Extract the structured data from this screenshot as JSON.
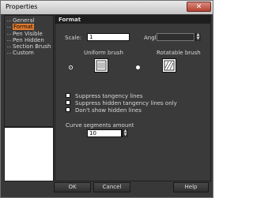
{
  "window": {
    "title": "Properties"
  },
  "sidebar": {
    "items": [
      {
        "label": "General"
      },
      {
        "label": "Format"
      },
      {
        "label": "Pen Visible"
      },
      {
        "label": "Pen Hidden"
      },
      {
        "label": "Section Brush"
      },
      {
        "label": "Custom"
      }
    ],
    "selected_index": 1
  },
  "panel": {
    "title": "Format",
    "scale": {
      "label": "Scale:",
      "value": "1"
    },
    "angle": {
      "label": "Angle:",
      "value": ""
    },
    "brush": {
      "uniform_label": "Uniform brush",
      "rotatable_label": "Rotatable brush",
      "selected": "uniform"
    },
    "checkboxes": [
      {
        "label": "Suppress tangency lines",
        "checked": false
      },
      {
        "label": "Suppress hidden tangency lines only",
        "checked": false
      },
      {
        "label": "Don't show hidden lines",
        "checked": false
      }
    ],
    "curve": {
      "label": "Curve segments amount",
      "value": "10"
    }
  },
  "buttons": {
    "ok": "OK",
    "cancel": "Cancel",
    "help": "Help"
  },
  "colors": {
    "selection": "#e07b30",
    "background": "#383838",
    "close": "#b3422f"
  }
}
